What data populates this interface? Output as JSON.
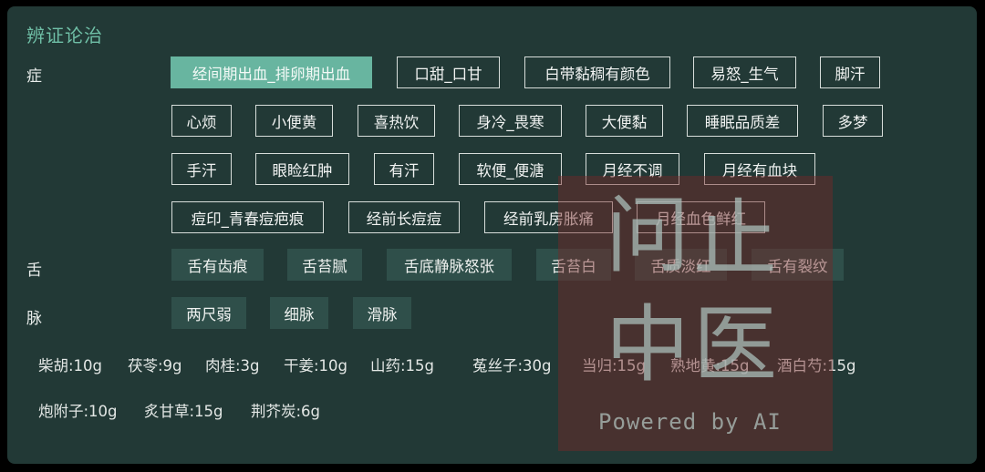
{
  "panel": {
    "title": "辨证论治"
  },
  "symptoms": {
    "label": "症",
    "items": [
      {
        "text": "经间期出血_排卵期出血",
        "selected": true
      },
      {
        "text": "口甜_口甘",
        "selected": false
      },
      {
        "text": "白带黏稠有颜色",
        "selected": false
      },
      {
        "text": "易怒_生气",
        "selected": false
      },
      {
        "text": "脚汗",
        "selected": false
      },
      {
        "text": "心烦",
        "selected": false
      },
      {
        "text": "小便黄",
        "selected": false
      },
      {
        "text": "喜热饮",
        "selected": false
      },
      {
        "text": "身冷_畏寒",
        "selected": false
      },
      {
        "text": "大便黏",
        "selected": false
      },
      {
        "text": "睡眠品质差",
        "selected": false
      },
      {
        "text": "多梦",
        "selected": false
      },
      {
        "text": "手汗",
        "selected": false
      },
      {
        "text": "眼睑红肿",
        "selected": false
      },
      {
        "text": "有汗",
        "selected": false
      },
      {
        "text": "软便_便溏",
        "selected": false
      },
      {
        "text": "月经不调",
        "selected": false
      },
      {
        "text": "月经有血块",
        "selected": false
      },
      {
        "text": "痘印_青春痘疤痕",
        "selected": false
      },
      {
        "text": "经前长痘痘",
        "selected": false
      },
      {
        "text": "经前乳房胀痛",
        "selected": false
      },
      {
        "text": "月经血色鲜红",
        "selected": false
      }
    ]
  },
  "tongue": {
    "label": "舌",
    "items": [
      "舌有齿痕",
      "舌苔腻",
      "舌底静脉怒张",
      "舌苔白",
      "舌质淡红",
      "舌有裂纹"
    ]
  },
  "pulse": {
    "label": "脉",
    "items": [
      "两尺弱",
      "细脉",
      "滑脉"
    ]
  },
  "prescription": {
    "items": [
      "柴胡:10g",
      "茯苓:9g",
      "肉桂:3g",
      "干姜:10g",
      "山药:15g",
      "菟丝子:30g",
      "当归:15g",
      "熟地黄:15g",
      "酒白芍:15g",
      "炮附子:10g",
      "炙甘草:15g",
      "荆芥炭:6g"
    ]
  },
  "watermark": {
    "chars": [
      "问",
      "止",
      "中",
      "医"
    ],
    "subtitle": "Powered by AI"
  },
  "colors": {
    "panel_bg": "#223936",
    "accent": "#6fbfa6",
    "selected_chip": "#68b5a0",
    "filled_chip": "#2f4f4a"
  }
}
